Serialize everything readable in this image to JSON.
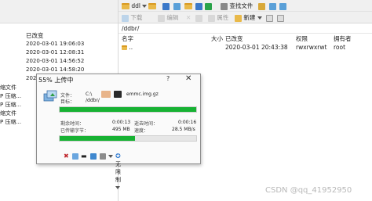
{
  "left_pane": {
    "toolbar_button": "下载",
    "header_modified": "已改变",
    "rows": [
      {
        "prefix": "",
        "date": "2020-03-01 19:06:03"
      },
      {
        "prefix": "",
        "date": "2020-03-01 12:08:31"
      },
      {
        "prefix": "",
        "date": "2020-03-01 14:56:52"
      },
      {
        "prefix": "",
        "date": "2020-03-01 14:58:20"
      },
      {
        "prefix": "",
        "date": "2020-03-01 ..."
      },
      {
        "prefix": "缩文件",
        "date": ""
      },
      {
        "prefix": "P 压缩...",
        "date": ""
      },
      {
        "prefix": "P 压缩...",
        "date": ""
      },
      {
        "prefix": "缩文件",
        "date": ""
      },
      {
        "prefix": "P 压缩...",
        "date": ""
      }
    ]
  },
  "right_pane": {
    "toolbar1": {
      "dir": "ddl",
      "find_files": "查找文件"
    },
    "toolbar2": {
      "download": "下载",
      "edit": "编辑",
      "properties": "属性",
      "new": "新建"
    },
    "path": "/ddbr/",
    "columns": {
      "name": "名字",
      "size": "大小",
      "modified": "已改变",
      "permissions": "权限",
      "owner": "拥有者"
    },
    "rows": [
      {
        "name": "..",
        "size": "",
        "modified": "2020-03-01 20:43:38",
        "permissions": "rwxrwxrwt",
        "owner": "root"
      }
    ]
  },
  "dialog": {
    "title": "55% 上传中",
    "help_label": "?",
    "close_label": "✕",
    "file_label": "文件：",
    "file_value_prefix": "C:\\",
    "file_value_suffix": "emmc.img.gz",
    "target_label": "目标：",
    "target_value": "/ddbr/",
    "file_progress": 1.0,
    "elapsed_label": "剩余时间：",
    "elapsed_value": "0:00:13",
    "transferred_label": "已传输字节：",
    "transferred_value": "495 MB",
    "remaining_label": "逝去时间：",
    "remaining_value": "0:00:16",
    "speed_label": "速度：",
    "speed_value": "28.5 MB/s",
    "total_progress": 0.55,
    "speed_limit": "无限制"
  },
  "watermark": "CSDN @qq_41952950"
}
